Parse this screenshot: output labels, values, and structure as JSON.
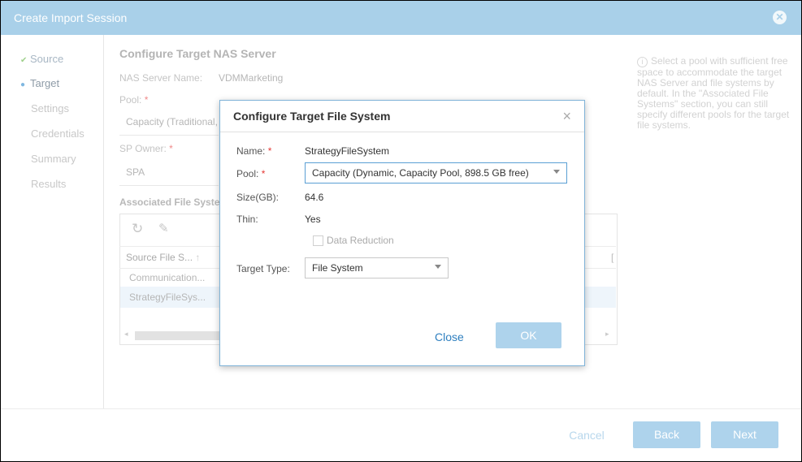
{
  "window": {
    "title": "Create Import Session"
  },
  "steps": [
    {
      "label": "Source",
      "state": "done"
    },
    {
      "label": "Target",
      "state": "current"
    },
    {
      "label": "Settings",
      "state": "pending"
    },
    {
      "label": "Credentials",
      "state": "pending"
    },
    {
      "label": "Summary",
      "state": "pending"
    },
    {
      "label": "Results",
      "state": "pending"
    }
  ],
  "main": {
    "section_title": "Configure Target NAS Server",
    "nas_server_name_label": "NAS Server Name:",
    "nas_server_name_value": "VDMMarketing",
    "pool_label": "Pool:",
    "pool_value": "Capacity (Traditional,",
    "sp_owner_label": "SP Owner:",
    "sp_owner_value": "SPA",
    "associated_label": "Associated File Syste",
    "table": {
      "header_col1": "Source File S...",
      "header_col2_fragment": "[",
      "rows": [
        "Communication...",
        "StrategyFileSys..."
      ]
    }
  },
  "help_text": "Select a pool with sufficient free space to accommodate the target NAS Server and file systems by default. In the \"Associated File Systems\" section, you can still specify different pools for the target file systems.",
  "footer": {
    "cancel": "Cancel",
    "back": "Back",
    "next": "Next"
  },
  "modal": {
    "title": "Configure Target File System",
    "name_label": "Name:",
    "name_value": "StrategyFileSystem",
    "pool_label": "Pool:",
    "pool_value": "Capacity (Dynamic, Capacity Pool, 898.5 GB free)",
    "size_label": "Size(GB):",
    "size_value": "64.6",
    "thin_label": "Thin:",
    "thin_value": "Yes",
    "data_reduction_label": "Data Reduction",
    "data_reduction_checked": false,
    "target_type_label": "Target Type:",
    "target_type_value": "File System",
    "close_label": "Close",
    "ok_label": "OK"
  },
  "required_mark": "*",
  "icons": {
    "done": "✔",
    "current": "●",
    "refresh": "↻",
    "edit": "✎",
    "sort_up": "↑",
    "close_x": "×"
  },
  "colors": {
    "accent": "#a9d0e9",
    "link": "#2e7fbf",
    "required": "#e53935"
  }
}
